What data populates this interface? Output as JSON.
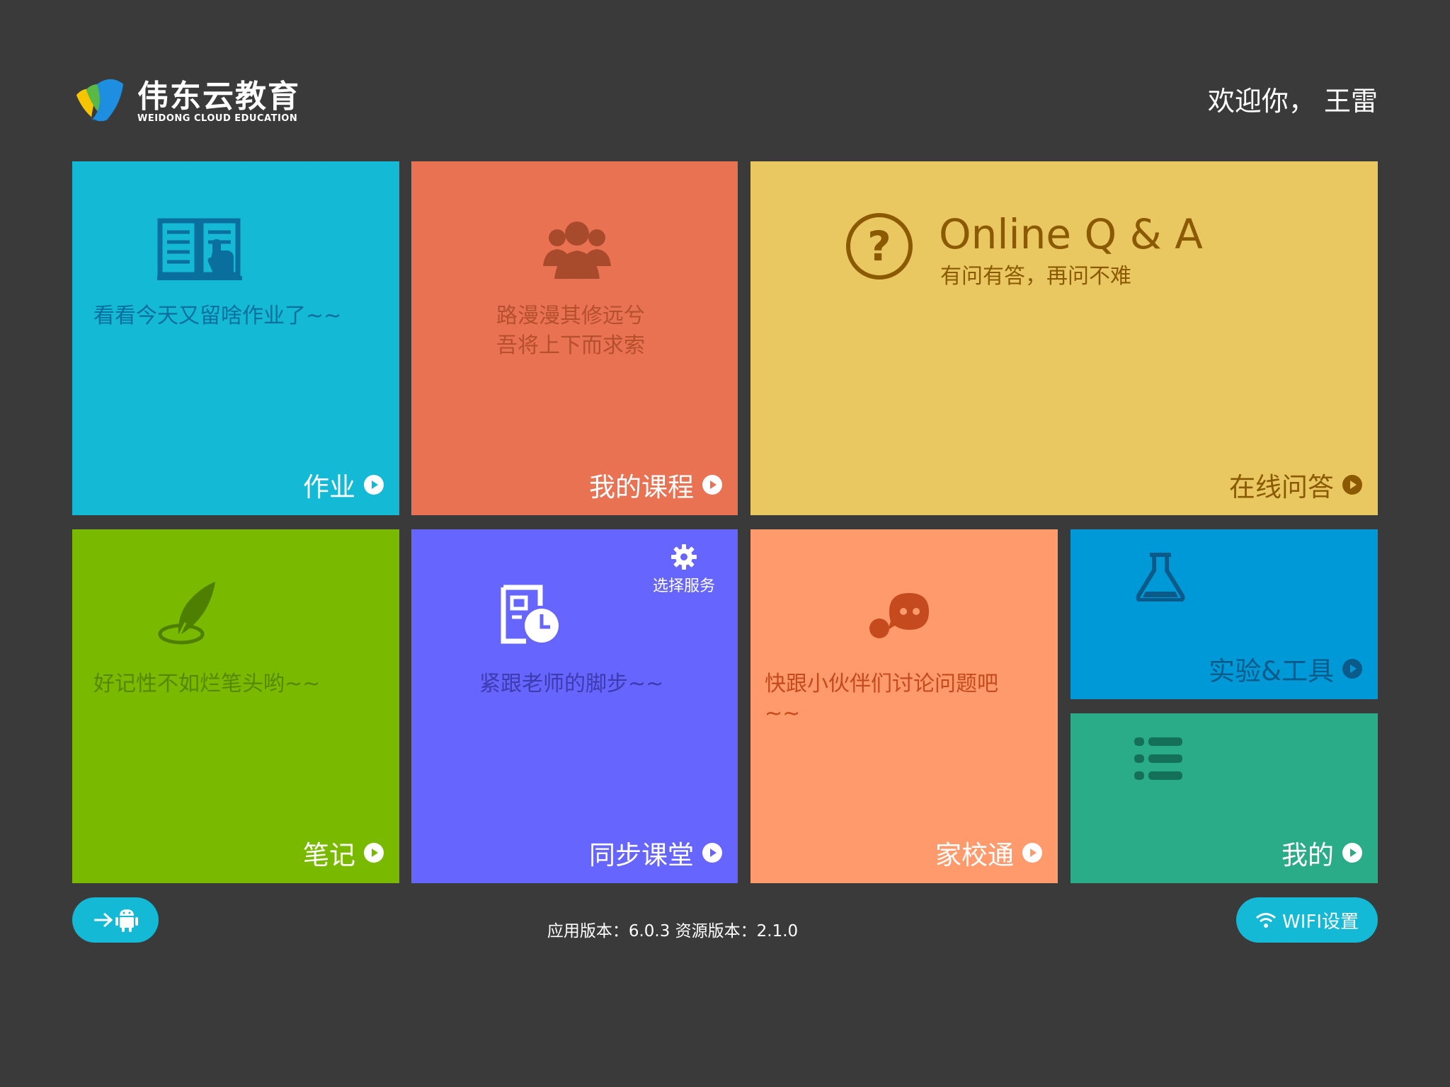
{
  "header": {
    "logo_cn": "伟东云教育",
    "logo_en": "WEIDONG CLOUD EDUCATION",
    "welcome": "欢迎你， 王雷"
  },
  "tiles": {
    "homework": {
      "label": "作业",
      "desc": "看看今天又留啥作业了~~",
      "icon": "book-icon"
    },
    "course": {
      "label": "我的课程",
      "desc_line1": "路漫漫其修远兮",
      "desc_line2": "吾将上下而求索",
      "icon": "group-icon"
    },
    "qa": {
      "label": "在线问答",
      "title": "Online Q & A",
      "subtitle": "有问有答，再问不难",
      "icon": "question-icon"
    },
    "note": {
      "label": "笔记",
      "desc": "好记性不如烂笔头哟~~",
      "icon": "feather-icon"
    },
    "sync": {
      "label": "同步课堂",
      "desc": "紧跟老师的脚步~~",
      "service": "选择服务",
      "icon": "schedule-icon"
    },
    "home_school": {
      "label": "家校通",
      "desc_line1": "快跟小伙伴们讨论问题吧",
      "desc_line2": "~~",
      "icon": "chat-icon"
    },
    "lab": {
      "label": "实验&工具",
      "icon": "flask-icon"
    },
    "mine": {
      "label": "我的",
      "icon": "list-icon"
    }
  },
  "footer": {
    "version": "应用版本：6.0.3 资源版本：2.1.0",
    "wifi_label": "WIFI设置",
    "android_icon": "android-icon"
  },
  "colors": {
    "background": "#3a3a3a",
    "homework": "#14b9d5",
    "course": "#e97253",
    "qa": "#e9c862",
    "note": "#79ba00",
    "sync": "#6665fd",
    "home_school": "#ff9a6c",
    "lab": "#0099d8",
    "mine": "#2aac89"
  }
}
